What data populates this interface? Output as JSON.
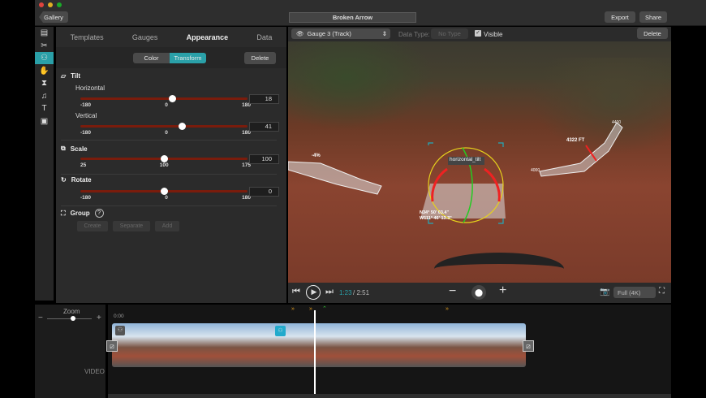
{
  "window": {
    "title": "Broken Arrow",
    "gallery": "Gallery",
    "export": "Export",
    "share": "Share"
  },
  "sidebar": {
    "icons": [
      "film-icon",
      "scissors-icon",
      "gauge-icon",
      "hand-icon",
      "crop-icon",
      "music-icon",
      "text-icon",
      "image-icon"
    ],
    "active": 2
  },
  "panel": {
    "tabs": [
      "Templates",
      "Gauges",
      "Appearance",
      "Data"
    ],
    "active_tab": "Appearance",
    "segments": [
      "Color",
      "Transform"
    ],
    "active_segment": "Transform",
    "delete": "Delete",
    "tilt": {
      "title": "Tilt",
      "horizontal": {
        "label": "Horizontal",
        "min": "-180",
        "mid": "0",
        "max": "180",
        "value": "18"
      },
      "vertical": {
        "label": "Vertical",
        "min": "-180",
        "mid": "0",
        "max": "180",
        "value": "41"
      }
    },
    "scale": {
      "title": "Scale",
      "min": "25",
      "mid": "100",
      "max": "175",
      "value": "100"
    },
    "rotate": {
      "title": "Rotate",
      "min": "-180",
      "mid": "0",
      "max": "180",
      "value": "0"
    },
    "group": {
      "title": "Group",
      "help": "?",
      "create": "Create",
      "separate": "Separate",
      "add": "Add"
    }
  },
  "viewer": {
    "gauge_select": "Gauge 3 (Track)",
    "data_type_label": "Data Type:",
    "data_type_value": "No Type",
    "visible_label": "Visible",
    "visible": true,
    "delete": "Delete",
    "overlay": {
      "label": "horizontal_tilt",
      "grade": "-4%",
      "altitude": "4322 FT",
      "alt_max": "4400",
      "alt_min": "4000",
      "coord1": "N34° 50' 03.4\"",
      "coord2": "W111° 46' 13.3\""
    },
    "time_current": "1:23",
    "time_total": "/ 2:51",
    "quality": "Full (4K)"
  },
  "timeline": {
    "zoom_label": "Zoom",
    "zoom_minus": "−",
    "zoom_plus": "+",
    "start_time": "0:00",
    "track_label": "VIDEO"
  },
  "colors": {
    "accent": "#2aa0a8",
    "slider": "#7a1c0c"
  }
}
